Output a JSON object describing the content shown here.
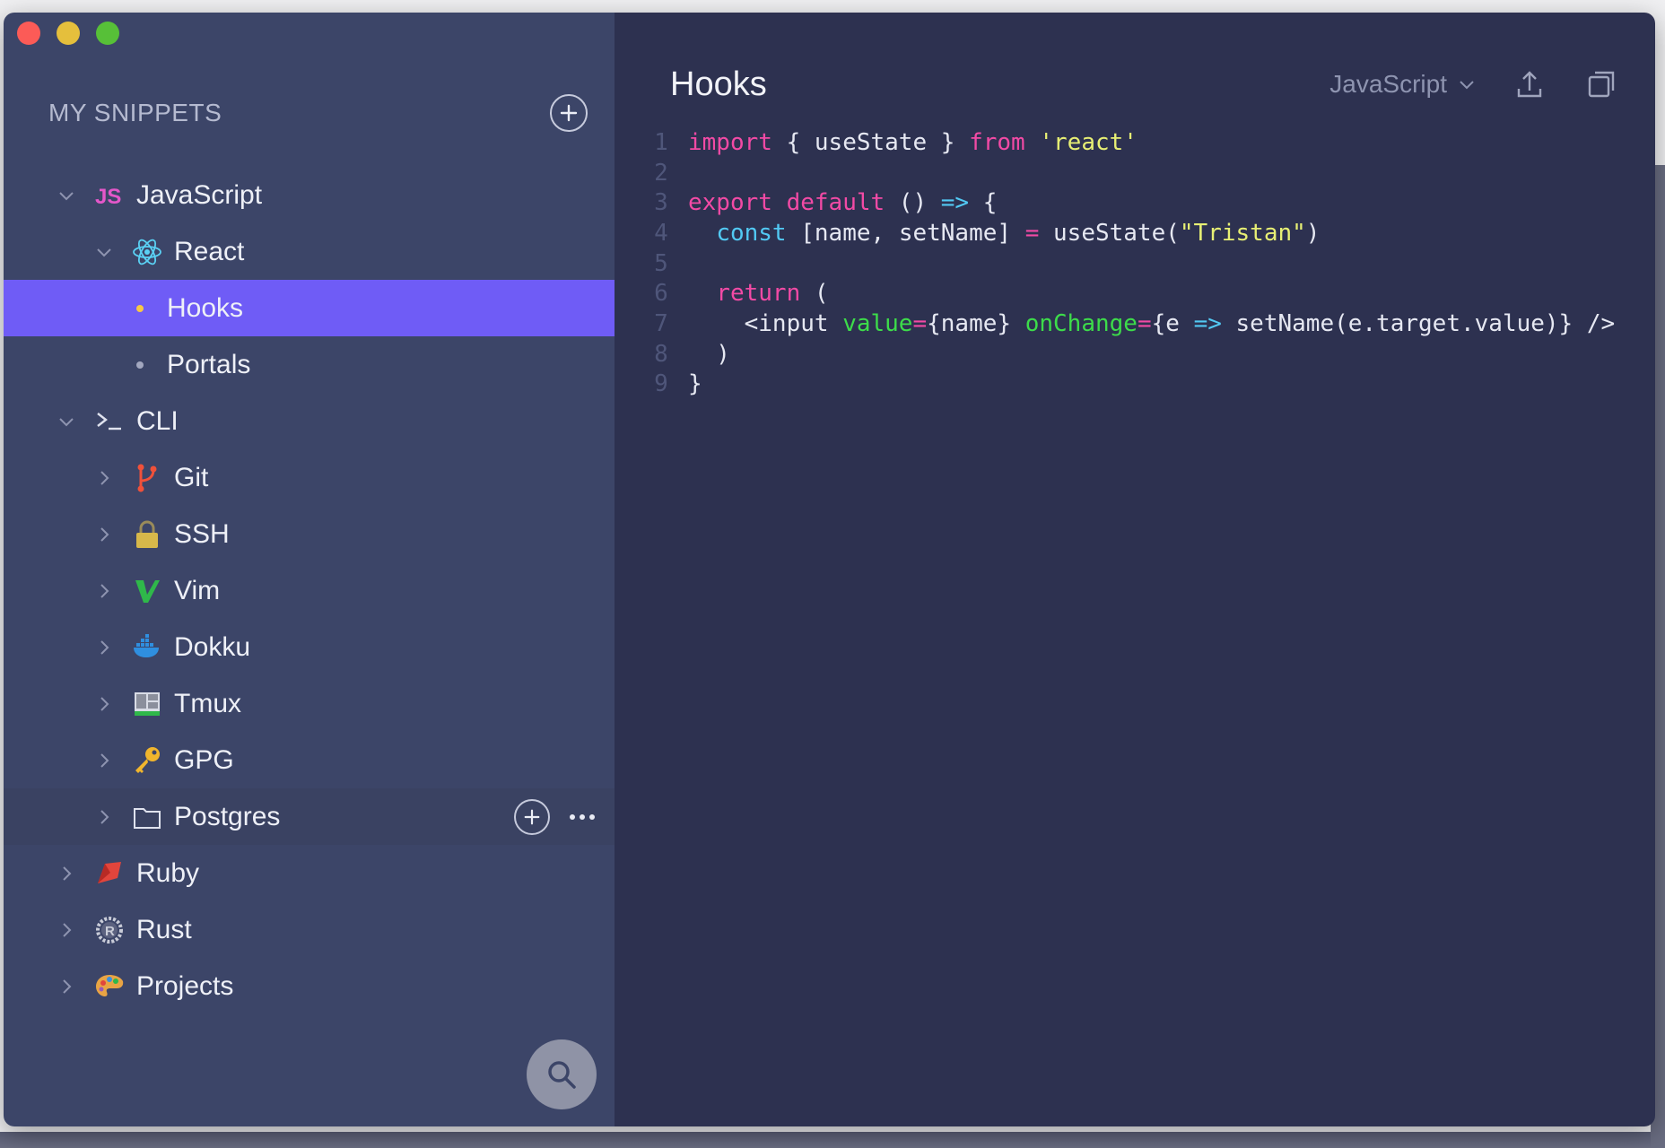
{
  "app": {
    "sidebar_title": "MY SNIPPETS"
  },
  "tree": [
    {
      "label": "JavaScript",
      "icon": "js-icon",
      "level": 0,
      "expanded": true
    },
    {
      "label": "React",
      "icon": "react-icon",
      "level": 1,
      "expanded": true
    },
    {
      "label": "Hooks",
      "icon": "dot",
      "level": 2,
      "selected": true
    },
    {
      "label": "Portals",
      "icon": "dot",
      "level": 2
    },
    {
      "label": "CLI",
      "icon": "terminal-icon",
      "level": 0,
      "expanded": true
    },
    {
      "label": "Git",
      "icon": "git-icon",
      "level": 1
    },
    {
      "label": "SSH",
      "icon": "lock-icon",
      "level": 1
    },
    {
      "label": "Vim",
      "icon": "vim-icon",
      "level": 1
    },
    {
      "label": "Dokku",
      "icon": "docker-icon",
      "level": 1
    },
    {
      "label": "Tmux",
      "icon": "tmux-icon",
      "level": 1
    },
    {
      "label": "GPG",
      "icon": "key-icon",
      "level": 1
    },
    {
      "label": "Postgres",
      "icon": "folder-icon",
      "level": 1,
      "hovered": true
    },
    {
      "label": "Ruby",
      "icon": "ruby-icon",
      "level": 0
    },
    {
      "label": "Rust",
      "icon": "rust-icon",
      "level": 0
    },
    {
      "label": "Projects",
      "icon": "palette-icon",
      "level": 0
    }
  ],
  "editor": {
    "title": "Hooks",
    "language": "JavaScript",
    "code_lines": [
      {
        "n": "1",
        "text": "import { useState } from 'react'"
      },
      {
        "n": "2",
        "text": ""
      },
      {
        "n": "3",
        "text": "export default () => {"
      },
      {
        "n": "4",
        "text": "  const [name, setName] = useState(\"Tristan\")"
      },
      {
        "n": "5",
        "text": ""
      },
      {
        "n": "6",
        "text": "  return ("
      },
      {
        "n": "7",
        "text": "    <input value={name} onChange={e => setName(e.target.value)} />"
      },
      {
        "n": "8",
        "text": "  )"
      },
      {
        "n": "9",
        "text": "}"
      }
    ]
  },
  "colors": {
    "sidebar_bg": "#3c4568",
    "editor_bg": "#2d3150",
    "selected": "#6f5cf6",
    "keyword": "#f24aa5",
    "string": "#e7ef74",
    "operator": "#52c9f3",
    "attribute": "#3ddc4a"
  }
}
